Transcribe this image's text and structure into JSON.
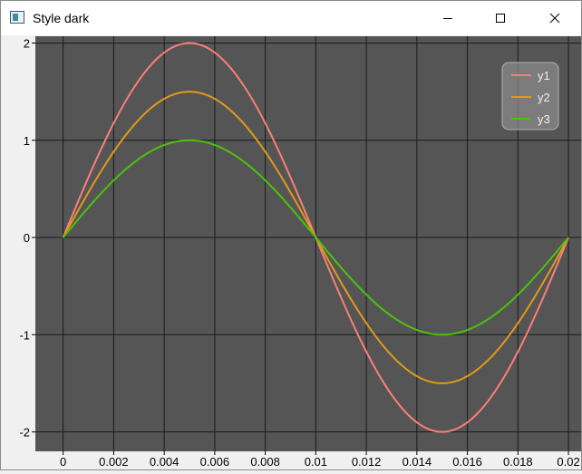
{
  "window": {
    "title": "Style dark",
    "controls": {
      "minimize": "minimize-icon",
      "maximize": "maximize-icon",
      "close": "close-icon"
    }
  },
  "colors": {
    "plot_background": "#555555",
    "grid": "#1a1a1a",
    "y1": "#f98079",
    "y2": "#e09a1a",
    "y3": "#4cc20c",
    "legend_background": "#8a8a8a",
    "legend_text": "#f0f0f0"
  },
  "chart_data": {
    "type": "line",
    "title": "",
    "xlabel": "",
    "ylabel": "",
    "xlim": [
      -0.0011,
      0.0205
    ],
    "ylim": [
      -2.2,
      2.07
    ],
    "x_ticks": [
      0,
      0.002,
      0.004,
      0.006,
      0.008,
      0.01,
      0.012,
      0.014,
      0.016,
      0.018,
      0.02
    ],
    "x_tick_labels": [
      "0",
      "0.002",
      "0.004",
      "0.006",
      "0.008",
      "0.01",
      "0.012",
      "0.014",
      "0.016",
      "0.018",
      "0.02"
    ],
    "y_ticks": [
      -2,
      -1,
      0,
      1,
      2
    ],
    "y_tick_labels": [
      "-2",
      "-1",
      "0",
      "1",
      "2"
    ],
    "grid": true,
    "legend_position": "top-right",
    "x": [
      0,
      0.001,
      0.002,
      0.003,
      0.004,
      0.005,
      0.006,
      0.007,
      0.008,
      0.009,
      0.01,
      0.011,
      0.012,
      0.013,
      0.014,
      0.015,
      0.016,
      0.017,
      0.018,
      0.019,
      0.02
    ],
    "series": [
      {
        "name": "y1",
        "values": [
          0,
          0.618,
          1.176,
          1.618,
          1.902,
          2.0,
          1.902,
          1.618,
          1.176,
          0.618,
          0,
          -0.618,
          -1.176,
          -1.618,
          -1.902,
          -2.0,
          -1.902,
          -1.618,
          -1.176,
          -0.618,
          0
        ]
      },
      {
        "name": "y2",
        "values": [
          0,
          0.464,
          0.882,
          1.214,
          1.427,
          1.5,
          1.427,
          1.214,
          0.882,
          0.464,
          0,
          -0.464,
          -0.882,
          -1.214,
          -1.427,
          -1.5,
          -1.427,
          -1.214,
          -0.882,
          -0.464,
          0
        ]
      },
      {
        "name": "y3",
        "values": [
          0,
          0.309,
          0.588,
          0.809,
          0.951,
          1.0,
          0.951,
          0.809,
          0.588,
          0.309,
          0,
          -0.309,
          -0.588,
          -0.809,
          -0.951,
          -1.0,
          -0.951,
          -0.809,
          -0.588,
          -0.309,
          0
        ]
      }
    ]
  }
}
